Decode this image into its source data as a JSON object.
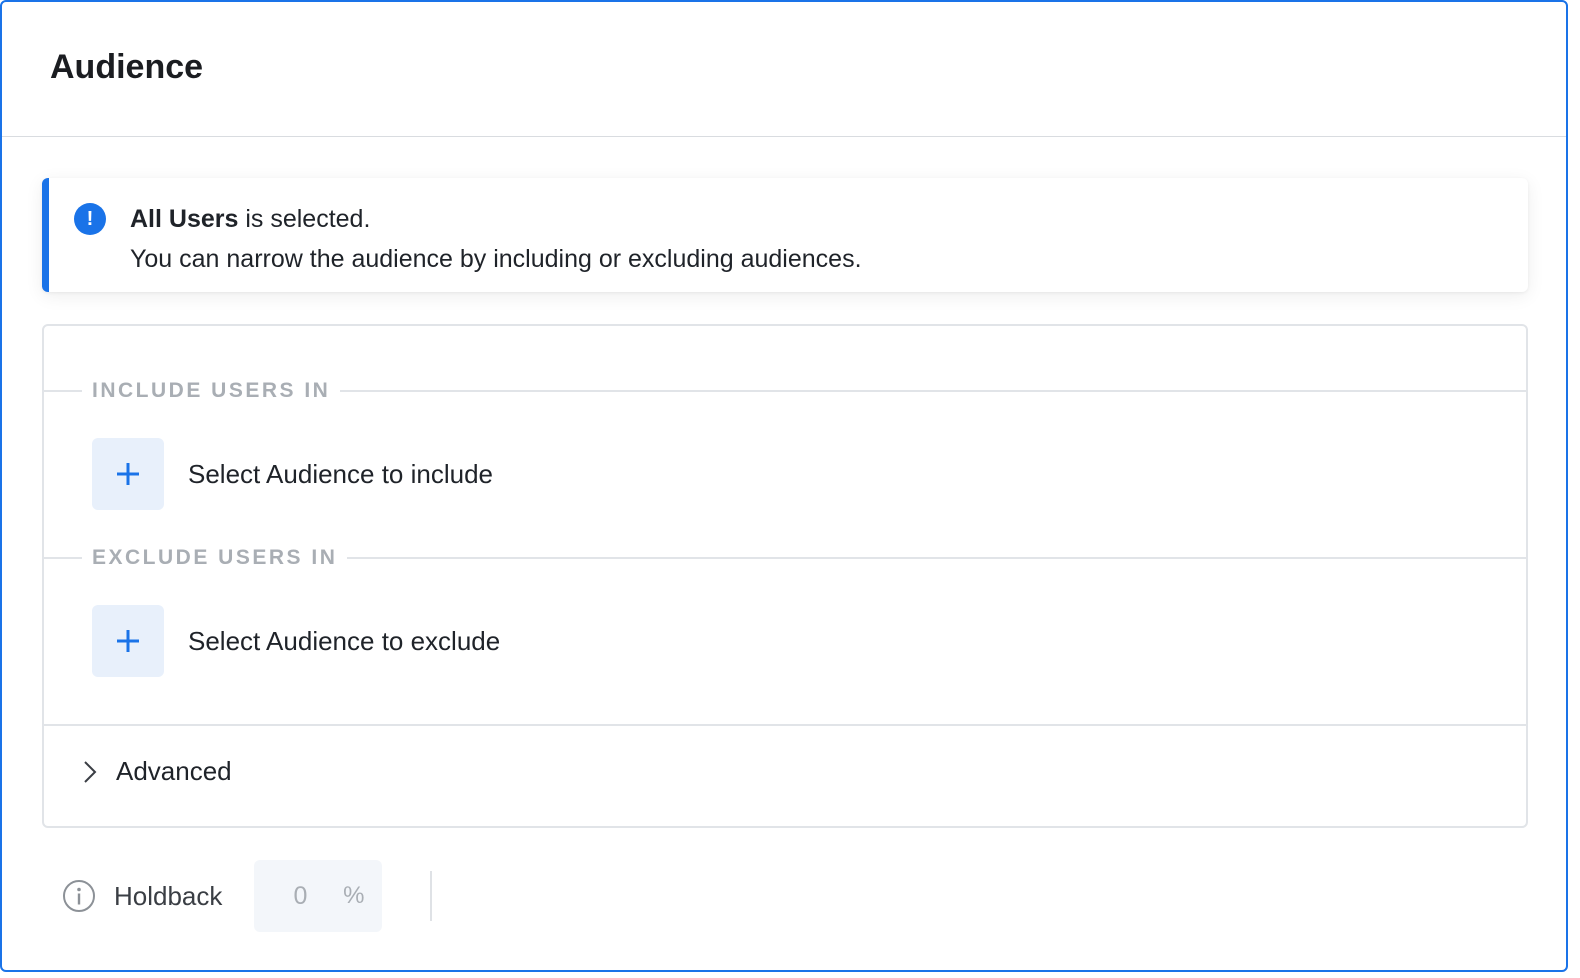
{
  "header": {
    "title": "Audience"
  },
  "banner": {
    "bold_text": "All Users",
    "rest_text": " is selected.",
    "description": "You can narrow the audience by including or excluding audiences.",
    "icon": "exclamation-icon",
    "accent_color": "#1a73e8"
  },
  "include": {
    "section_label": "INCLUDE USERS IN",
    "button_label": "Select Audience to include",
    "icon": "plus-icon"
  },
  "exclude": {
    "section_label": "EXCLUDE USERS IN",
    "button_label": "Select Audience to exclude",
    "icon": "plus-icon"
  },
  "advanced": {
    "label": "Advanced",
    "icon": "chevron-right-icon"
  },
  "holdback": {
    "label": "Holdback",
    "value": "0",
    "unit": "%",
    "icon": "info-circle-icon"
  }
}
